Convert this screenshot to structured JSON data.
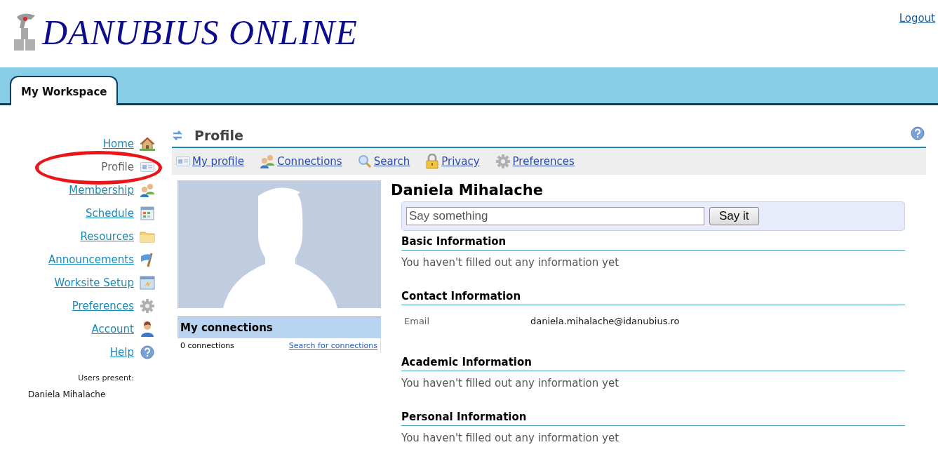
{
  "header": {
    "logo_text": "DANUBIUS ONLINE",
    "logout": "Logout"
  },
  "tabs": [
    {
      "label": "My Workspace",
      "selected": true
    }
  ],
  "sidebar": {
    "items": [
      {
        "label": "Home",
        "selected": false
      },
      {
        "label": "Profile",
        "selected": true
      },
      {
        "label": "Membership",
        "selected": false
      },
      {
        "label": "Schedule",
        "selected": false
      },
      {
        "label": "Resources",
        "selected": false
      },
      {
        "label": "Announcements",
        "selected": false
      },
      {
        "label": "Worksite Setup",
        "selected": false
      },
      {
        "label": "Preferences",
        "selected": false
      },
      {
        "label": "Account",
        "selected": false
      },
      {
        "label": "Help",
        "selected": false
      }
    ],
    "users_present_label": "Users present:",
    "users_present": [
      "Daniela Mihalache"
    ]
  },
  "page": {
    "title": "Profile",
    "toolbar": [
      "My profile",
      "Connections",
      "Search",
      "Privacy",
      "Preferences"
    ],
    "connections": {
      "title": "My connections",
      "count": "0 connections",
      "link": "Search for connections"
    },
    "name": "Daniela Mihalache",
    "status": {
      "placeholder": "Say something",
      "button": "Say it"
    },
    "sections": [
      {
        "kind": "message",
        "title": "Basic Information",
        "text": "You haven't filled out any information yet"
      },
      {
        "kind": "fields",
        "title": "Contact Information",
        "fields": [
          {
            "label": "Email",
            "value": "daniela.mihalache@idanubius.ro"
          }
        ]
      },
      {
        "kind": "message",
        "title": "Academic Information",
        "text": "You haven't filled out any information yet"
      },
      {
        "kind": "message",
        "title": "Personal Information",
        "text": "You haven't filled out any information yet"
      }
    ]
  }
}
